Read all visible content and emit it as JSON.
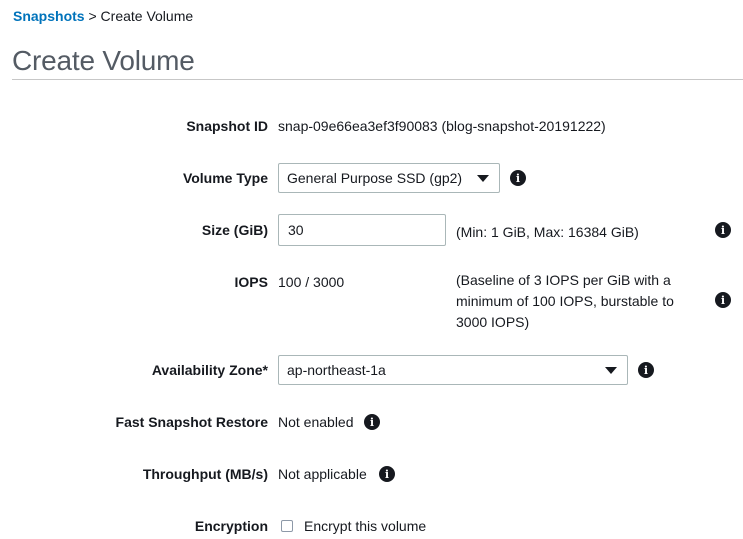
{
  "breadcrumb": {
    "snapshots_link": "Snapshots",
    "separator": ">",
    "current": "Create Volume"
  },
  "page_title": "Create Volume",
  "form": {
    "snapshot_id": {
      "label": "Snapshot ID",
      "value": "snap-09e66ea3ef3f90083 (blog-snapshot-20191222)"
    },
    "volume_type": {
      "label": "Volume Type",
      "selected": "General Purpose SSD (gp2)"
    },
    "size": {
      "label": "Size (GiB)",
      "value": "30",
      "hint": "(Min: 1 GiB, Max: 16384 GiB)"
    },
    "iops": {
      "label": "IOPS",
      "value": "100 / 3000",
      "hint_line1": "(Baseline of 3 IOPS per GiB with a",
      "hint_line2": "minimum of 100 IOPS, burstable to",
      "hint_line3": "3000 IOPS)"
    },
    "availability_zone": {
      "label": "Availability Zone*",
      "selected": "ap-northeast-1a"
    },
    "fast_snapshot_restore": {
      "label": "Fast Snapshot Restore",
      "value": "Not enabled"
    },
    "throughput": {
      "label": "Throughput (MB/s)",
      "value": "Not applicable"
    },
    "encryption": {
      "label": "Encryption",
      "checkbox_label": "Encrypt this volume",
      "checked": false
    }
  },
  "info_glyph": "i",
  "colors": {
    "link": "#0073bb",
    "title": "#545b64",
    "text": "#16191f",
    "border": "#aab7b8"
  }
}
